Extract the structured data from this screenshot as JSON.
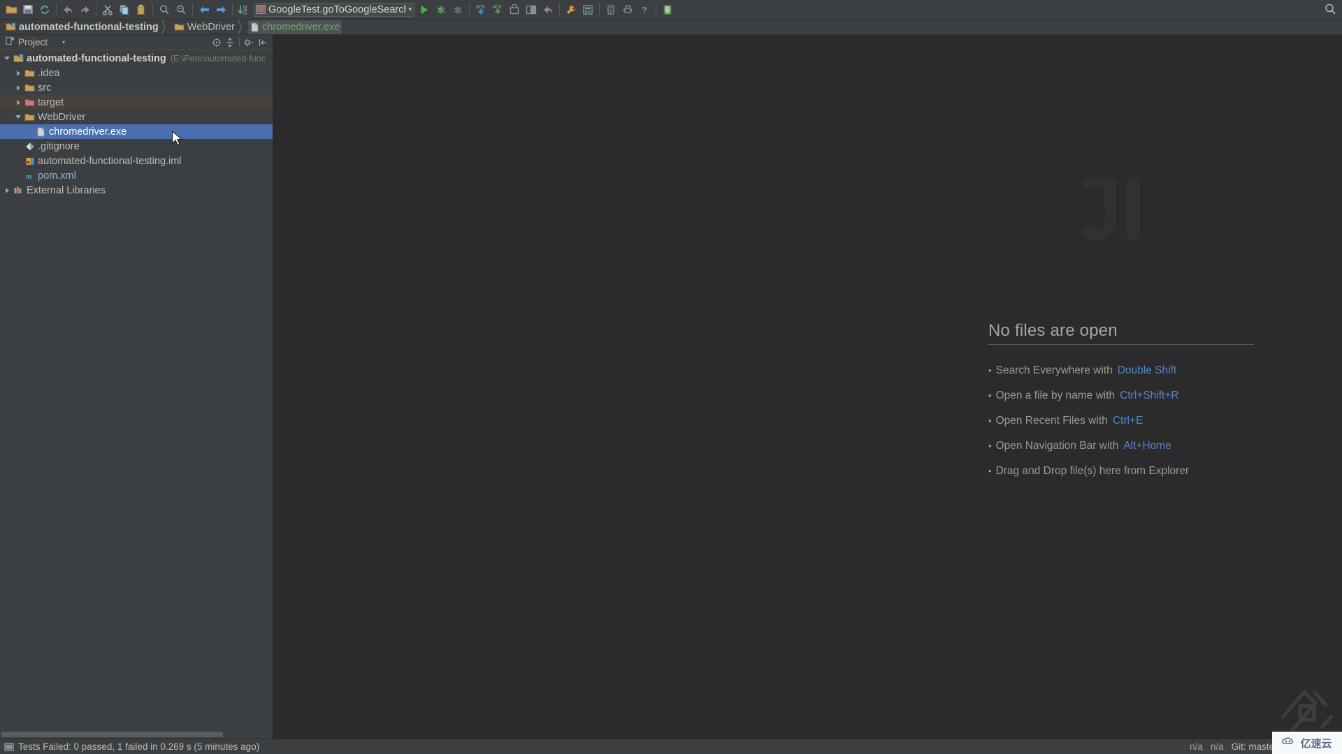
{
  "window": {
    "app": "IntelliJ IDEA",
    "background_watermark": "IJ"
  },
  "toolbar": {
    "buttons": [
      {
        "name": "open-folder-icon",
        "tooltip": "Open"
      },
      {
        "name": "save-all-icon",
        "tooltip": "Save All"
      },
      {
        "name": "sync-refresh-icon",
        "tooltip": "Synchronize"
      },
      {
        "name": "undo-icon",
        "tooltip": "Undo"
      },
      {
        "name": "redo-icon",
        "tooltip": "Redo"
      },
      {
        "name": "cut-icon",
        "tooltip": "Cut"
      },
      {
        "name": "copy-icon",
        "tooltip": "Copy"
      },
      {
        "name": "paste-icon",
        "tooltip": "Paste"
      },
      {
        "name": "find-icon",
        "tooltip": "Find"
      },
      {
        "name": "replace-icon",
        "tooltip": "Replace"
      },
      {
        "name": "back-icon",
        "tooltip": "Back"
      },
      {
        "name": "forward-icon",
        "tooltip": "Forward"
      },
      {
        "name": "compile-icon",
        "tooltip": "Compile"
      }
    ],
    "run_config": {
      "label": "GoogleTest.goToGoogleSearch",
      "dropdown_arrow": "▾"
    },
    "right_buttons": [
      {
        "name": "run-icon",
        "tooltip": "Run"
      },
      {
        "name": "debug-icon",
        "tooltip": "Debug"
      },
      {
        "name": "run-with-coverage-icon",
        "tooltip": "Run with Coverage"
      },
      {
        "name": "vcs-update-icon",
        "label": "VCS",
        "tooltip": "Update Project"
      },
      {
        "name": "vcs-commit-icon",
        "label": "VCS",
        "tooltip": "Commit"
      },
      {
        "name": "vcs-history-icon",
        "tooltip": "History"
      },
      {
        "name": "vcs-compare-icon",
        "tooltip": "Compare"
      },
      {
        "name": "rollback-icon",
        "tooltip": "Rollback"
      },
      {
        "name": "settings-wrench-icon",
        "tooltip": "Settings"
      },
      {
        "name": "project-structure-icon",
        "tooltip": "Project Structure"
      },
      {
        "name": "sdk-manager-icon",
        "tooltip": "SDK Manager"
      },
      {
        "name": "android-avd-icon",
        "tooltip": "AVD Manager"
      },
      {
        "name": "help-icon",
        "label": "?",
        "tooltip": "Help"
      },
      {
        "name": "android-device-monitor-icon",
        "tooltip": "Android Device Monitor"
      }
    ],
    "search_icon": "search-everywhere-icon"
  },
  "navbar": {
    "crumbs": [
      {
        "label": "automated-functional-testing",
        "type": "module",
        "icon": "module-icon"
      },
      {
        "label": "WebDriver",
        "type": "folder",
        "icon": "folder-icon"
      },
      {
        "label": "chromedriver.exe",
        "type": "file",
        "icon": "file-icon"
      }
    ],
    "separator": "〉"
  },
  "project_panel": {
    "tab_label": "Project",
    "tab_icon": "project-view-icon",
    "tab_dropdown": "▾",
    "tools": [
      {
        "name": "scroll-from-source-icon",
        "tooltip": "Select Opened File"
      },
      {
        "name": "collapse-all-icon",
        "tooltip": "Collapse All"
      },
      {
        "name": "settings-gear-icon",
        "tooltip": "Show Options Menu"
      },
      {
        "name": "hide-panel-icon",
        "tooltip": "Hide"
      }
    ],
    "tree": [
      {
        "label": "automated-functional-testing",
        "path": "(E:\\Pere\\automated-func",
        "depth": 0,
        "state": "expanded",
        "icon": "module-icon",
        "style": "bold",
        "selected": false
      },
      {
        "label": ".idea",
        "depth": 1,
        "state": "collapsed",
        "icon": "folder-icon",
        "selected": false
      },
      {
        "label": "src",
        "depth": 1,
        "state": "collapsed",
        "icon": "folder-icon",
        "selected": false
      },
      {
        "label": "target",
        "depth": 1,
        "state": "collapsed",
        "icon": "folder-excluded-icon",
        "selected": false,
        "highlight": true
      },
      {
        "label": "WebDriver",
        "depth": 1,
        "state": "expanded",
        "icon": "folder-icon",
        "selected": false
      },
      {
        "label": "chromedriver.exe",
        "depth": 2,
        "state": "leaf",
        "icon": "file-icon",
        "selected": true
      },
      {
        "label": ".gitignore",
        "depth": 1,
        "state": "leaf",
        "icon": "gitignore-icon",
        "selected": false
      },
      {
        "label": "automated-functional-testing.iml",
        "depth": 1,
        "state": "leaf",
        "icon": "iml-icon",
        "selected": false
      },
      {
        "label": "pom.xml",
        "depth": 1,
        "state": "leaf",
        "icon": "maven-icon",
        "style": "pom",
        "selected": false
      },
      {
        "label": "External Libraries",
        "depth": 0,
        "state": "collapsed",
        "icon": "libraries-icon",
        "selected": false
      }
    ]
  },
  "editor": {
    "empty_title": "No files are open",
    "hints": [
      {
        "text": "Search Everywhere with",
        "shortcut": "Double Shift"
      },
      {
        "text": "Open a file by name with",
        "shortcut": "Ctrl+Shift+R"
      },
      {
        "text": "Open Recent Files with",
        "shortcut": "Ctrl+E"
      },
      {
        "text": "Open Navigation Bar with",
        "shortcut": "Alt+Home"
      },
      {
        "text": "Drag and Drop file(s) here from Explorer",
        "shortcut": ""
      }
    ],
    "bullet": "•"
  },
  "statusbar": {
    "icon": "tests-status-icon",
    "message": "Tests Failed: 0 passed, 1 failed in 0.269 s (5 minutes ago)",
    "right": {
      "caret_na_1": "n/a",
      "caret_na_2": "n/a",
      "git_label": "Git: master",
      "git_arrow": "⇅",
      "lock_icon": "lock-icon",
      "memory_icon": "memory-indicator-icon"
    }
  },
  "overlay_watermark": {
    "text": "亿速云",
    "logo_icon": "cloud-logo-icon"
  },
  "colors": {
    "toolbar_bg": "#3c3f41",
    "editor_bg": "#2b2b2b",
    "selection_blue": "#4b6eaf",
    "shortcut_blue": "#5486c9",
    "text": "#bbbbbb",
    "file_green": "#72a96b",
    "pom_blue": "#8fb6d6",
    "folder_amber": "#c8a05a",
    "target_red": "#c97b7b"
  }
}
